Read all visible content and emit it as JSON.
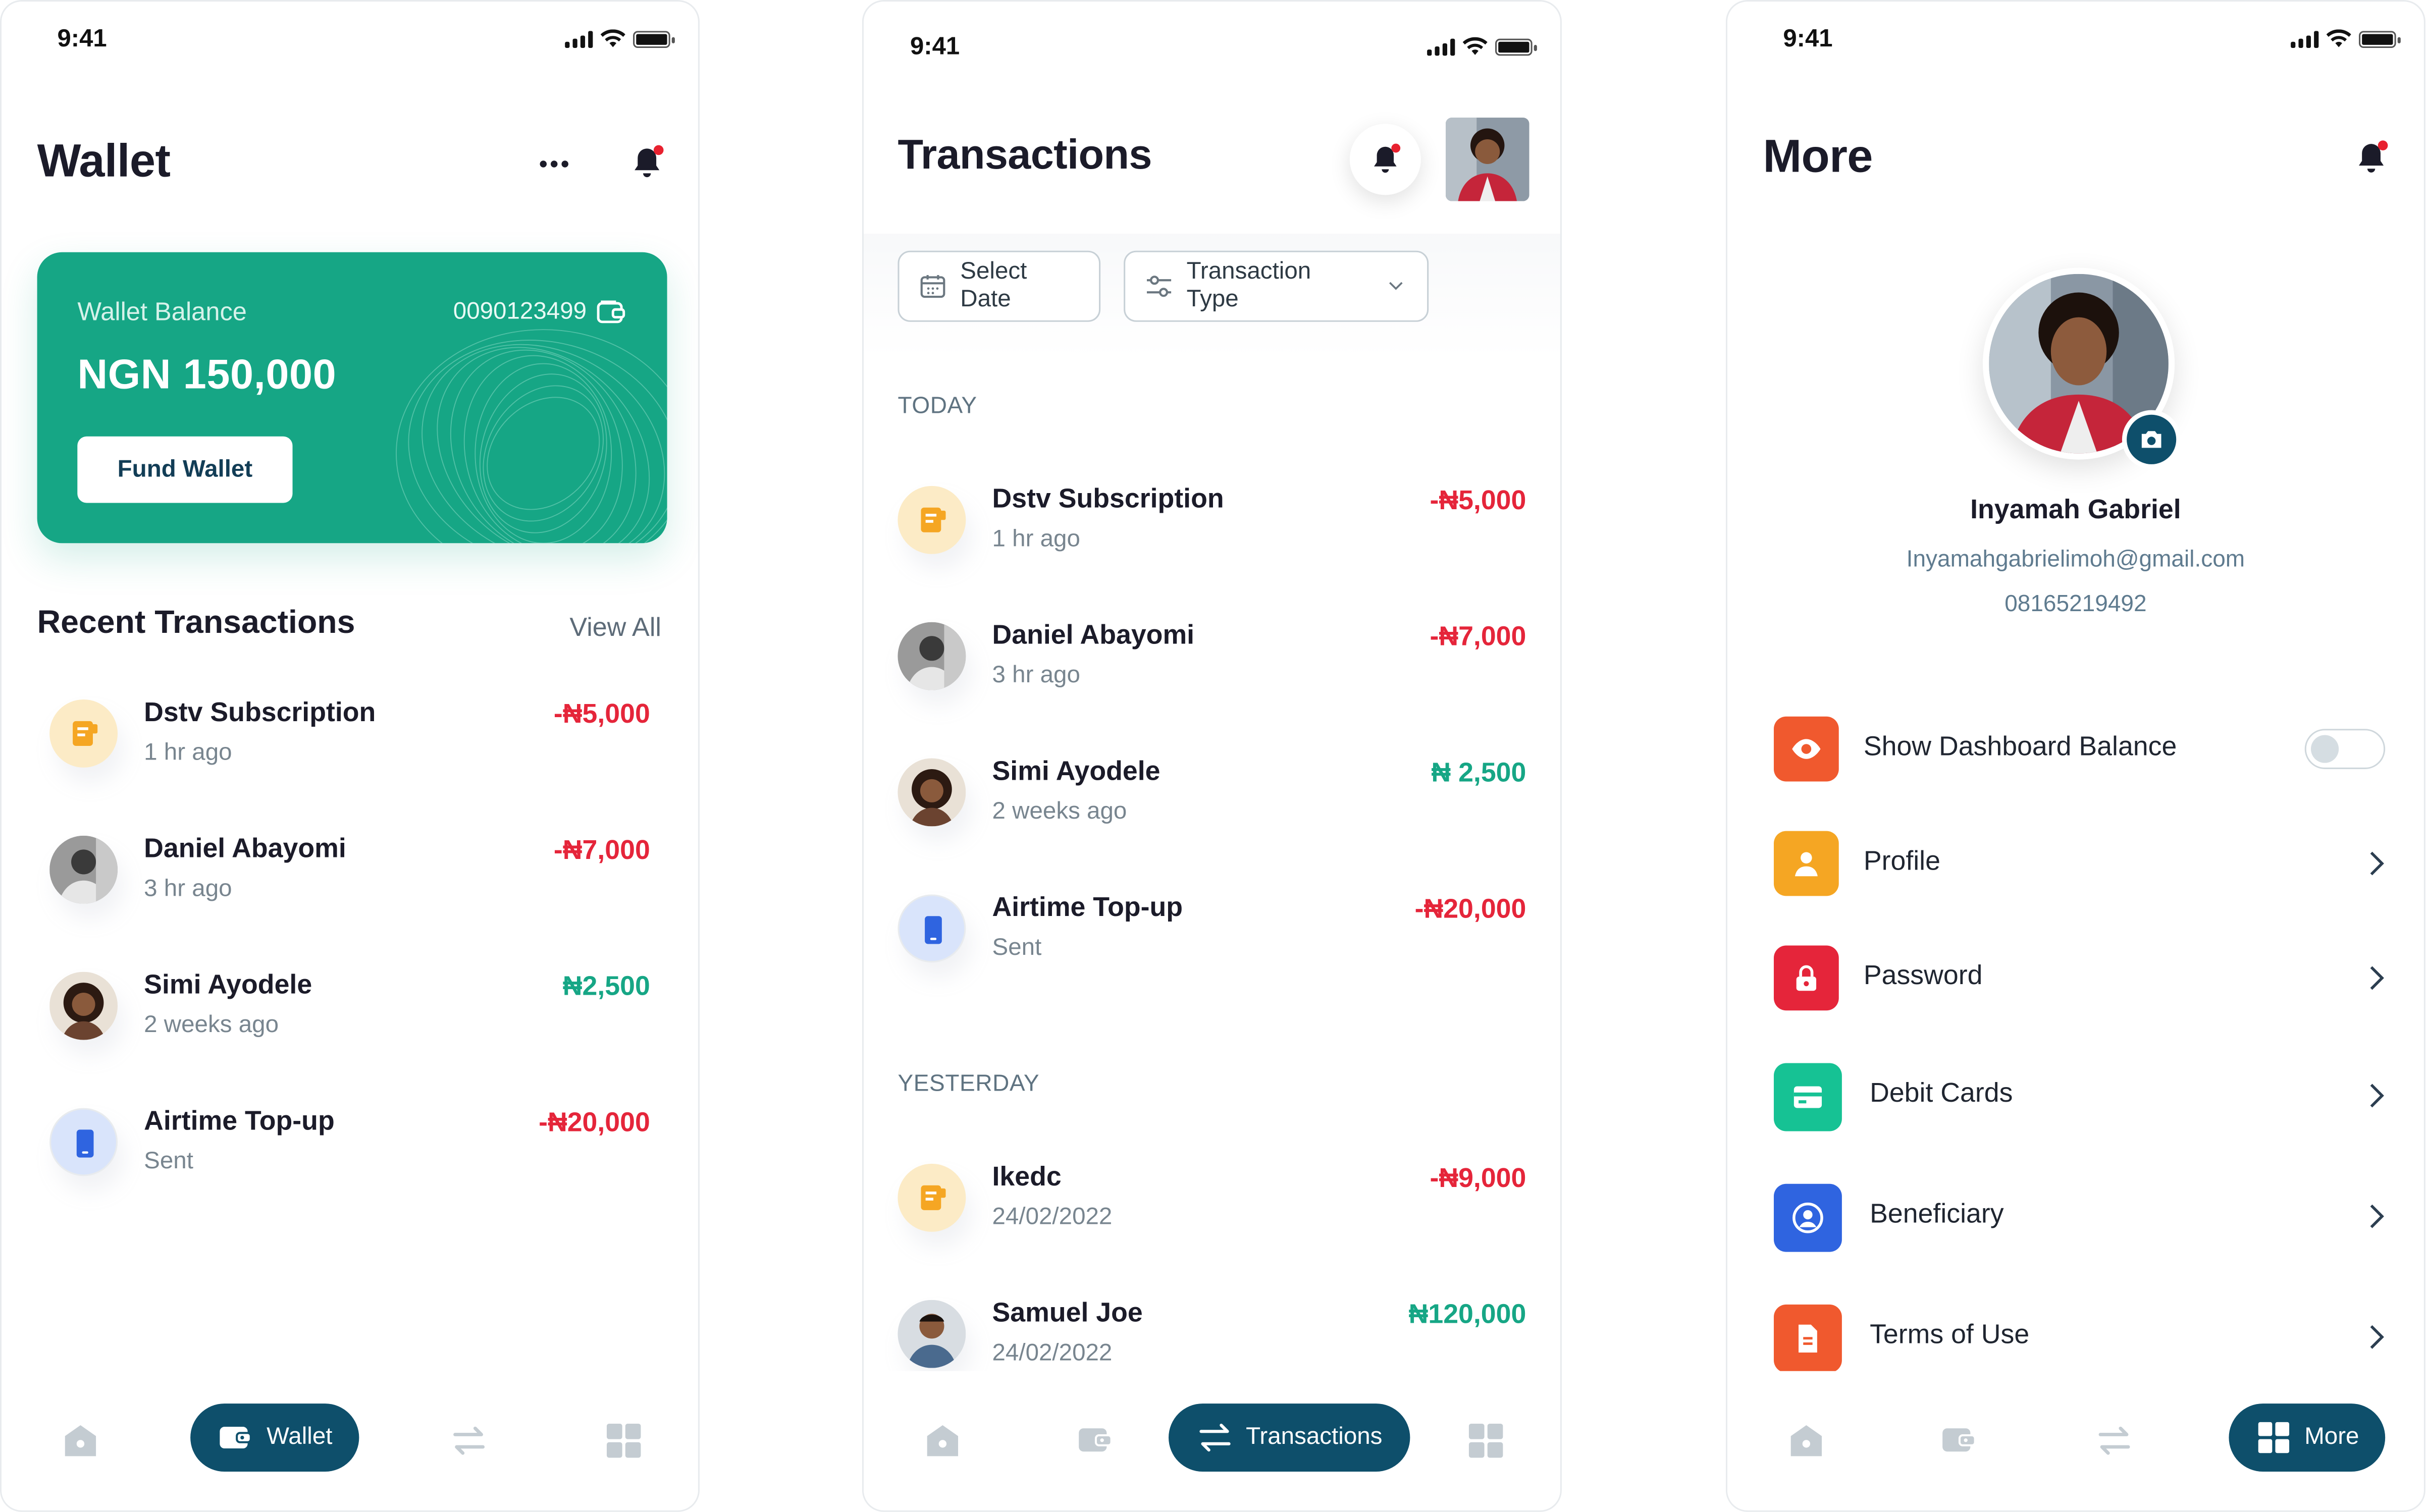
{
  "status": {
    "time": "9:41"
  },
  "wallet": {
    "title": "Wallet",
    "card": {
      "label": "Wallet Balance",
      "account": "0090123499",
      "balance": "NGN 150,000",
      "fund_button": "Fund Wallet"
    },
    "recent_title": "Recent Transactions",
    "view_all": "View All",
    "transactions": [
      {
        "name": "Dstv Subscription",
        "sub": "1 hr ago",
        "amount": "-₦5,000",
        "type": "debit",
        "icon": "bill-icon"
      },
      {
        "name": "Daniel Abayomi",
        "sub": "3 hr ago",
        "amount": "-₦7,000",
        "type": "debit",
        "icon": "avatar"
      },
      {
        "name": "Simi Ayodele",
        "sub": "2 weeks ago",
        "amount": "₦2,500",
        "type": "credit",
        "icon": "avatar"
      },
      {
        "name": "Airtime Top-up",
        "sub": "Sent",
        "amount": "-₦20,000",
        "type": "debit",
        "icon": "phone-icon"
      }
    ],
    "nav_active": "Wallet"
  },
  "transactions": {
    "title": "Transactions",
    "filters": {
      "date": "Select Date",
      "type": "Transaction Type"
    },
    "today_label": "TODAY",
    "yesterday_label": "YESTERDAY",
    "today": [
      {
        "name": "Dstv Subscription",
        "sub": "1 hr ago",
        "amount": "-₦5,000",
        "type": "debit"
      },
      {
        "name": "Daniel Abayomi",
        "sub": "3 hr ago",
        "amount": "-₦7,000",
        "type": "debit"
      },
      {
        "name": "Simi Ayodele",
        "sub": "2 weeks ago",
        "amount": "₦ 2,500",
        "type": "credit"
      },
      {
        "name": "Airtime Top-up",
        "sub": "Sent",
        "amount": "-₦20,000",
        "type": "debit"
      }
    ],
    "yesterday": [
      {
        "name": "Ikedc",
        "sub": "24/02/2022",
        "amount": "-₦9,000",
        "type": "debit"
      },
      {
        "name": "Samuel Joe",
        "sub": "24/02/2022",
        "amount": "₦120,000",
        "type": "credit"
      }
    ],
    "nav_active": "Transactions"
  },
  "more": {
    "title": "More",
    "profile": {
      "name": "Inyamah Gabriel",
      "email": "Inyamahgabrielimoh@gmail.com",
      "phone": "08165219492"
    },
    "menu": [
      {
        "label": "Show Dashboard Balance",
        "icon": "eye-icon",
        "color": "#f0592e",
        "control": "toggle",
        "toggle_on": false
      },
      {
        "label": "Profile",
        "icon": "user-icon",
        "color": "#f5a623",
        "control": "chevron"
      },
      {
        "label": "Password",
        "icon": "lock-icon",
        "color": "#e5253a",
        "control": "chevron"
      },
      {
        "label": "Debit Cards",
        "icon": "card-icon",
        "color": "#16c294",
        "control": "chevron"
      },
      {
        "label": "Beneficiary",
        "icon": "user-circle-icon",
        "color": "#2f64e0",
        "control": "chevron"
      },
      {
        "label": "Terms of Use",
        "icon": "document-icon",
        "color": "#f0592e",
        "control": "chevron"
      }
    ],
    "nav_active": "More"
  },
  "colors": {
    "brand_green": "#16a685",
    "nav_active": "#0e4f6b",
    "debit": "#e5253a",
    "credit": "#16a685"
  }
}
